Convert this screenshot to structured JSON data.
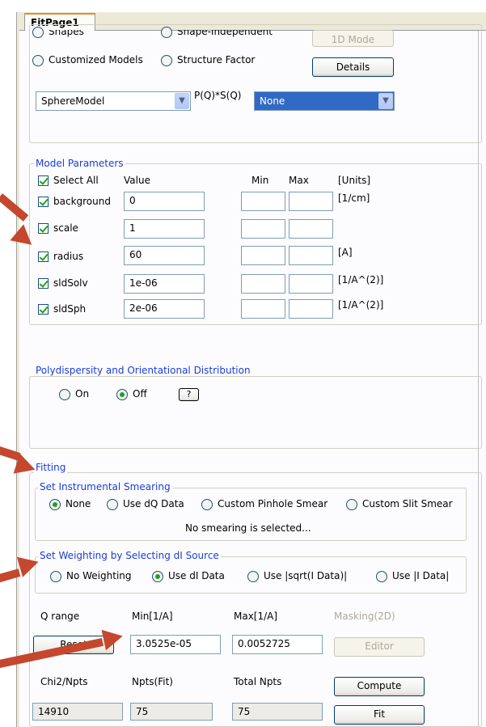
{
  "tab": {
    "title": "FitPage1"
  },
  "top": {
    "clipped_radio1": "Shapes",
    "clipped_radio2": "Shape-Independent",
    "mode_button": "1D Mode",
    "customized_label": "Customized Models",
    "structure_label": "Structure Factor",
    "details_button": "Details",
    "model_select": "SphereModel",
    "pq_label": "P(Q)*S(Q)",
    "structure_select": "None"
  },
  "model_params": {
    "legend": "Model Parameters",
    "select_all": "Select All",
    "col_value": "Value",
    "col_min": "Min",
    "col_max": "Max",
    "col_units": "[Units]",
    "rows": [
      {
        "name": "background",
        "value": "0",
        "unit": "[1/cm]"
      },
      {
        "name": "scale",
        "value": "1",
        "unit": ""
      },
      {
        "name": "radius",
        "value": "60",
        "unit": "[A]"
      },
      {
        "name": "sldSolv",
        "value": "1e-06",
        "unit": "[1/A^(2)]"
      },
      {
        "name": "sldSph",
        "value": "2e-06",
        "unit": "[1/A^(2)]"
      }
    ]
  },
  "poly": {
    "legend": "Polydispersity and Orientational Distribution",
    "on": "On",
    "off": "Off",
    "help": "?"
  },
  "fitting": {
    "legend": "Fitting",
    "smear_legend": "Set Instrumental Smearing",
    "smear_none": "None",
    "smear_dq": "Use dQ Data",
    "smear_pinhole": "Custom Pinhole Smear",
    "smear_slit": "Custom Slit Smear",
    "smear_status": "No smearing is selected...",
    "weight_legend": "Set Weighting by Selecting dI Source",
    "weight_none": "No Weighting",
    "weight_di": "Use dI Data",
    "weight_sqrt": "Use |sqrt(I Data)|",
    "weight_i": "Use |I Data|",
    "qrange_label": "Q range",
    "min_label": "Min[1/A]",
    "max_label": "Max[1/A]",
    "masking_label": "Masking(2D)",
    "reset_button": "Reset",
    "qmin": "3.0525e-05",
    "qmax": "0.0052725",
    "editor_button": "Editor",
    "chi_label": "Chi2/Npts",
    "npts_fit_label": "Npts(Fit)",
    "total_npts_label": "Total Npts",
    "compute_button": "Compute",
    "chi_value": "14910",
    "npts_fit_value": "75",
    "total_npts_value": "75",
    "fit_button": "Fit"
  },
  "colors": {
    "legend_blue": "#1a3ddb",
    "annotation_arrow": "#c4472e",
    "selected_blue": "#316ac5"
  }
}
